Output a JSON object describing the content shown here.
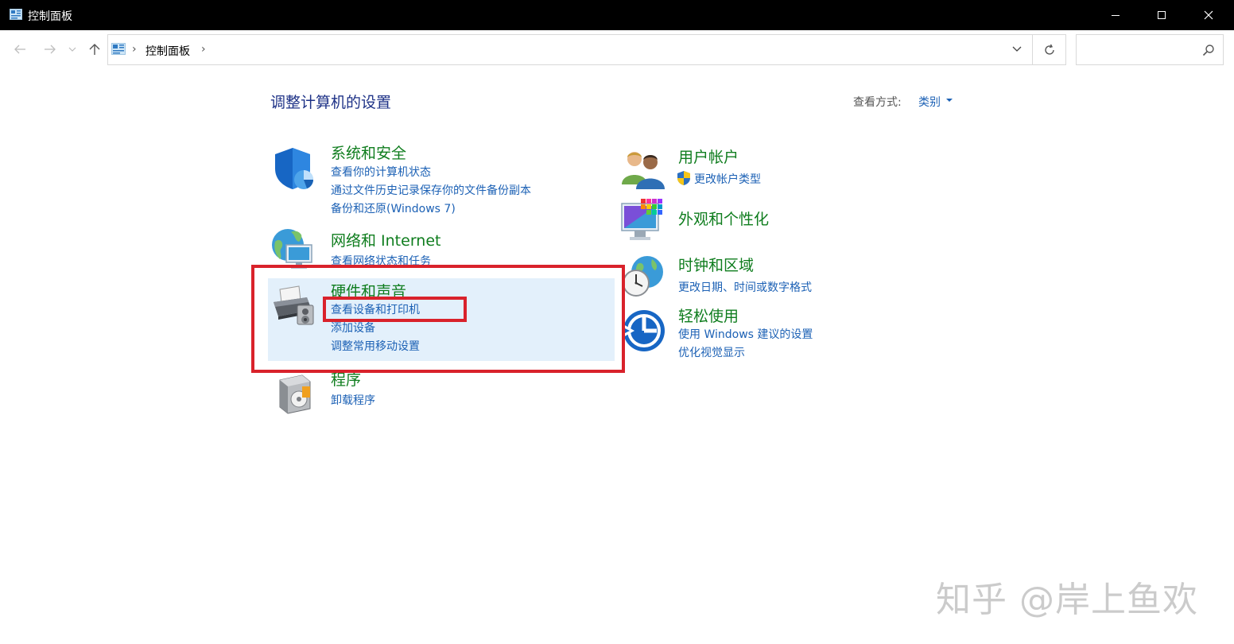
{
  "window": {
    "title": "控制面板"
  },
  "address": {
    "crumb": "控制面板",
    "search_placeholder": ""
  },
  "main": {
    "heading": "调整计算机的设置",
    "viewby_label": "查看方式:",
    "viewby_value": "类别"
  },
  "categories": {
    "system": {
      "title": "系统和安全",
      "links": [
        "查看你的计算机状态",
        "通过文件历史记录保存你的文件备份副本",
        "备份和还原(Windows 7)"
      ]
    },
    "network": {
      "title": "网络和 Internet",
      "links": [
        "查看网络状态和任务"
      ]
    },
    "hardware": {
      "title": "硬件和声音",
      "links": [
        "查看设备和打印机",
        "添加设备",
        "调整常用移动设置"
      ]
    },
    "programs": {
      "title": "程序",
      "links": [
        "卸载程序"
      ]
    },
    "users": {
      "title": "用户帐户",
      "links": [
        "更改帐户类型"
      ]
    },
    "appearance": {
      "title": "外观和个性化",
      "links": []
    },
    "clock": {
      "title": "时钟和区域",
      "links": [
        "更改日期、时间或数字格式"
      ]
    },
    "ease": {
      "title": "轻松使用",
      "links": [
        "使用 Windows 建议的设置",
        "优化视觉显示"
      ]
    }
  },
  "watermark": "知乎 @岸上鱼欢",
  "colors": {
    "category_title": "#0f7d1e",
    "link": "#1c61b5",
    "heading": "#1e3287",
    "highlight_panel": "#e3f0fb",
    "annotation_red": "#d9222b"
  },
  "icons": [
    "control-panel-icon",
    "back-arrow-icon",
    "forward-arrow-icon",
    "recent-chevron-icon",
    "up-arrow-icon",
    "chevron-down-icon",
    "refresh-icon",
    "search-icon",
    "shield-icon",
    "globe-network-icon",
    "printer-icon",
    "programs-box-icon",
    "users-icon",
    "uac-shield-icon",
    "display-palette-icon",
    "clock-globe-icon",
    "ease-of-access-icon"
  ]
}
